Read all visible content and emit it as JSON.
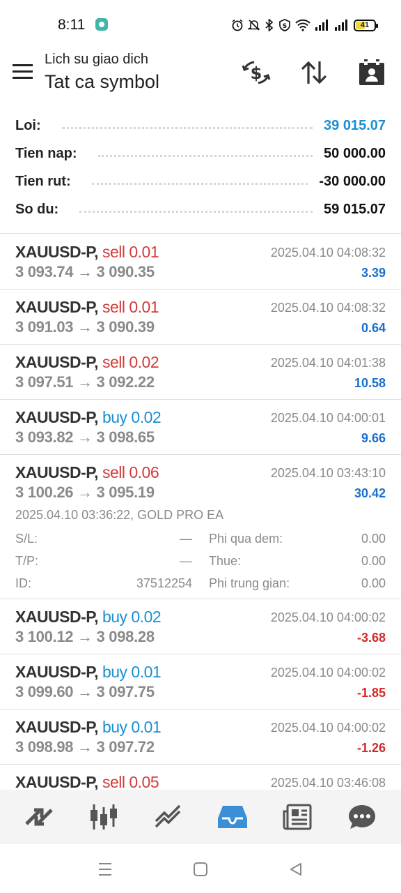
{
  "status_bar": {
    "time": "8:11",
    "battery": "41",
    "icons": [
      "app-icon",
      "alarm-icon",
      "mute-icon",
      "bluetooth-icon",
      "shield-icon",
      "wifi-icon",
      "signal-icon",
      "signal-icon-2",
      "battery-icon"
    ]
  },
  "header": {
    "subtitle": "Lich su giao dich",
    "title": "Tat ca symbol",
    "actions": [
      "currency-exchange-icon",
      "sort-icon",
      "calendar-icon"
    ]
  },
  "summary": [
    {
      "label": "Loi:",
      "value": "39 015.07",
      "color": "#1a8fd1"
    },
    {
      "label": "Tien nap:",
      "value": "50 000.00",
      "color": "#111111"
    },
    {
      "label": "Tien rut:",
      "value": "-30 000.00",
      "color": "#111111"
    },
    {
      "label": "So du:",
      "value": "59 015.07",
      "color": "#111111"
    }
  ],
  "trades": [
    {
      "symbol": "XAUUSD-P,",
      "side": "sell",
      "volume": "0.01",
      "prices": "3 093.74 → 3 090.35",
      "time": "2025.04.10 04:08:32",
      "profit": "3.39",
      "sign": "pos"
    },
    {
      "symbol": "XAUUSD-P,",
      "side": "sell",
      "volume": "0.01",
      "prices": "3 091.03 → 3 090.39",
      "time": "2025.04.10 04:08:32",
      "profit": "0.64",
      "sign": "pos"
    },
    {
      "symbol": "XAUUSD-P,",
      "side": "sell",
      "volume": "0.02",
      "prices": "3 097.51 → 3 092.22",
      "time": "2025.04.10 04:01:38",
      "profit": "10.58",
      "sign": "pos"
    },
    {
      "symbol": "XAUUSD-P,",
      "side": "buy",
      "volume": "0.02",
      "prices": "3 093.82 → 3 098.65",
      "time": "2025.04.10 04:00:01",
      "profit": "9.66",
      "sign": "pos"
    },
    {
      "symbol": "XAUUSD-P,",
      "side": "sell",
      "volume": "0.06",
      "prices": "3 100.26 → 3 095.19",
      "time": "2025.04.10 03:43:10",
      "profit": "30.42",
      "sign": "pos",
      "details": {
        "open_info": "2025.04.10 03:36:22, GOLD PRO EA",
        "rows": [
          {
            "l1": "S/L:",
            "v1": "—",
            "l2": "Phi qua dem:",
            "v2": "0.00"
          },
          {
            "l1": "T/P:",
            "v1": "—",
            "l2": "Thue:",
            "v2": "0.00"
          },
          {
            "l1": "ID:",
            "v1": "37512254",
            "l2": "Phi trung gian:",
            "v2": "0.00"
          }
        ]
      }
    },
    {
      "symbol": "XAUUSD-P,",
      "side": "buy",
      "volume": "0.02",
      "prices": "3 100.12 → 3 098.28",
      "time": "2025.04.10 04:00:02",
      "profit": "-3.68",
      "sign": "neg"
    },
    {
      "symbol": "XAUUSD-P,",
      "side": "buy",
      "volume": "0.01",
      "prices": "3 099.60 → 3 097.75",
      "time": "2025.04.10 04:00:02",
      "profit": "-1.85",
      "sign": "neg"
    },
    {
      "symbol": "XAUUSD-P,",
      "side": "buy",
      "volume": "0.01",
      "prices": "3 098.98 → 3 097.72",
      "time": "2025.04.10 04:00:02",
      "profit": "-1.26",
      "sign": "neg"
    },
    {
      "symbol": "XAUUSD-P,",
      "side": "sell",
      "volume": "0.05",
      "prices": "",
      "time": "2025.04.10 03:46:08",
      "profit": "",
      "sign": "pos"
    }
  ],
  "bottom_nav": [
    {
      "icon": "quotes-icon",
      "active": false
    },
    {
      "icon": "chart-candles-icon",
      "active": false
    },
    {
      "icon": "trade-icon",
      "active": false
    },
    {
      "icon": "history-inbox-icon",
      "active": true
    },
    {
      "icon": "news-icon",
      "active": false
    },
    {
      "icon": "chat-icon",
      "active": false
    }
  ],
  "colors": {
    "accent": "#1a8fd1",
    "sell": "#d13b3b",
    "buy": "#1a8fd1",
    "profit_pos": "#1a6fcf",
    "profit_neg": "#d12b2b"
  }
}
